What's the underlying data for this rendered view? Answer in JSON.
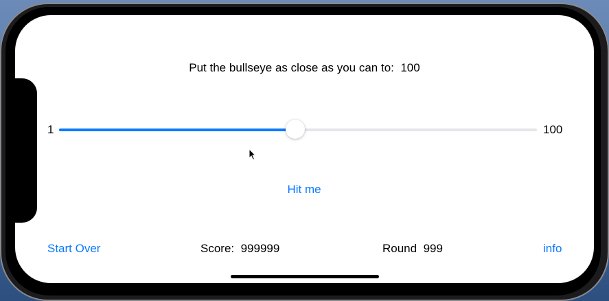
{
  "prompt": {
    "label": "Put the bullseye as close as you can to:",
    "target": "100"
  },
  "slider": {
    "min_label": "1",
    "max_label": "100",
    "value_fraction": 0.494
  },
  "actions": {
    "hit_label": "Hit me",
    "start_over_label": "Start Over",
    "info_label": "info"
  },
  "stats": {
    "score_label": "Score:",
    "score_value": "999999",
    "round_label": "Round",
    "round_value": "999"
  },
  "colors": {
    "accent": "#0a7aff",
    "track": "#e5e5ea"
  },
  "icons": {
    "cursor": "pointer-cursor-icon"
  }
}
